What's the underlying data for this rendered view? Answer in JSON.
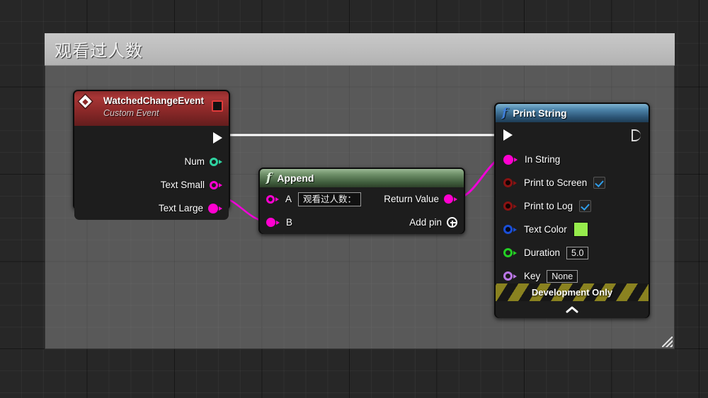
{
  "graph": {
    "comment": {
      "title": "观看过人数"
    },
    "nodes": {
      "event": {
        "title": "WatchedChangeEvent",
        "subtitle": "Custom Event",
        "icon": "event-diamond-icon",
        "stop_icon": "stop-square-icon",
        "exec_out": "exec-out-pin",
        "outputs": [
          {
            "label": "Num",
            "pin": "int-pin",
            "color": "#2fd2a0",
            "filled": false
          },
          {
            "label": "Text Small",
            "pin": "string-pin",
            "color": "#ff00d0",
            "filled": false
          },
          {
            "label": "Text Large",
            "pin": "string-pin",
            "color": "#ff00d0",
            "filled": true
          }
        ]
      },
      "append": {
        "title": "Append",
        "icon": "function-f-icon",
        "input_a": {
          "label": "A",
          "value": "观看过人数：",
          "pin": "string-pin",
          "color": "#ff00d0",
          "filled": false
        },
        "input_b": {
          "label": "B",
          "pin": "string-pin",
          "color": "#ff00d0",
          "filled": true
        },
        "return_value": {
          "label": "Return Value",
          "pin": "string-pin",
          "color": "#ff00d0",
          "filled": true
        },
        "add_pin": {
          "label": "Add pin",
          "icon": "plus-circle-icon"
        }
      },
      "print": {
        "title": "Print String",
        "icon": "function-f-icon",
        "exec_in": "exec-in-pin",
        "exec_out": "exec-out-pin",
        "pins": [
          {
            "label": "In String",
            "pin": "string-pin",
            "color": "#ff00d0",
            "filled": true,
            "widget": "none"
          },
          {
            "label": "Print to Screen",
            "pin": "bool-pin",
            "color": "#8b1212",
            "filled": false,
            "widget": "checkbox",
            "checked": true
          },
          {
            "label": "Print to Log",
            "pin": "bool-pin",
            "color": "#8b1212",
            "filled": false,
            "widget": "checkbox",
            "checked": true
          },
          {
            "label": "Text Color",
            "pin": "linearcolor-pin",
            "color": "#1a4fd8",
            "filled": false,
            "widget": "swatch",
            "swatch": "#96ec4c"
          },
          {
            "label": "Duration",
            "pin": "float-pin",
            "color": "#24d024",
            "filled": false,
            "widget": "number",
            "value": "5.0"
          },
          {
            "label": "Key",
            "pin": "name-pin",
            "color": "#bb77e8",
            "filled": false,
            "widget": "text",
            "value": "None"
          }
        ],
        "development_only": "Development Only",
        "collapse_icon": "chevron-up-icon"
      }
    },
    "wires": [
      {
        "name": "exec-wire-event-to-print",
        "type": "exec",
        "color": "#ffffff"
      },
      {
        "name": "data-wire-textlarge-to-b",
        "type": "data",
        "color": "#f0f"
      },
      {
        "name": "data-wire-return-to-instring",
        "type": "data",
        "color": "#f0f"
      }
    ]
  }
}
